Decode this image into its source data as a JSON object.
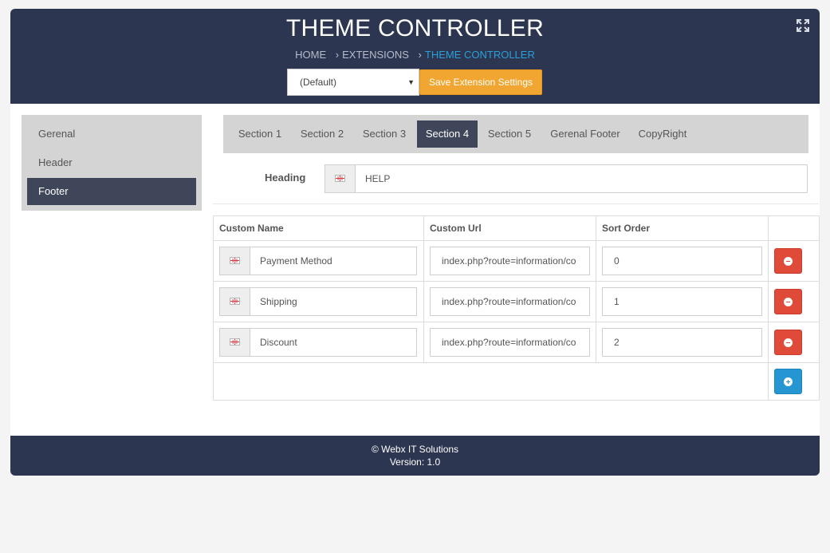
{
  "header": {
    "title": "THEME CONTROLLER",
    "breadcrumb": [
      "HOME",
      "EXTENSIONS",
      "THEME CONTROLLER"
    ],
    "breadcrumb_separator": "›",
    "store_select_value": "(Default)",
    "save_label": "Save Extension Settings"
  },
  "sidebar": {
    "items": [
      {
        "label": "Gerenal"
      },
      {
        "label": "Header"
      },
      {
        "label": "Footer",
        "active": true
      }
    ]
  },
  "tabs": [
    {
      "label": "Section 1"
    },
    {
      "label": "Section 2"
    },
    {
      "label": "Section 3"
    },
    {
      "label": "Section 4",
      "active": true
    },
    {
      "label": "Section 5"
    },
    {
      "label": "Gerenal Footer"
    },
    {
      "label": "CopyRight"
    }
  ],
  "heading": {
    "label": "Heading",
    "value": "HELP"
  },
  "table": {
    "columns": [
      "Custom Name",
      "Custom Url",
      "Sort Order",
      ""
    ],
    "rows": [
      {
        "name": "Payment Method",
        "url": "index.php?route=information/co",
        "sort": "0"
      },
      {
        "name": "Shipping",
        "url": "index.php?route=information/co",
        "sort": "1"
      },
      {
        "name": "Discount",
        "url": "index.php?route=information/co",
        "sort": "2"
      }
    ]
  },
  "footer": {
    "copyright": "© Webx IT Solutions",
    "version": "Version: 1.0"
  },
  "colors": {
    "header_bg": "#2c3651",
    "accent_orange": "#f0a630",
    "active_tab": "#3f4659",
    "breadcrumb_active": "#2a9fd8",
    "delete_red": "#e04a38",
    "add_blue": "#2596d2"
  },
  "icons": [
    "expand-icon",
    "flag-icon",
    "minus-circle-icon",
    "plus-circle-icon",
    "caret-down-icon"
  ]
}
